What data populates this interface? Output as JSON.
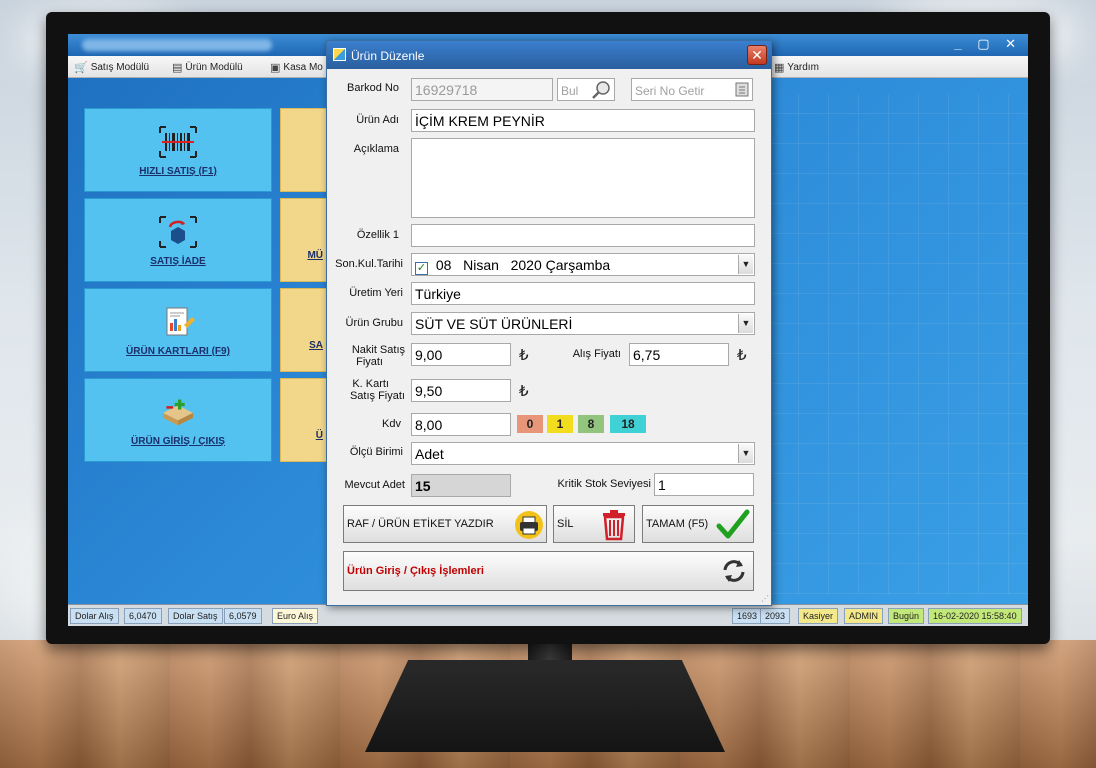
{
  "background_app": {
    "menu": [
      {
        "label": "Satış Modülü",
        "icon": "cart-icon"
      },
      {
        "label": "Ürün Modülü",
        "icon": "box-icon"
      },
      {
        "label": "Kasa Mo",
        "icon": "register-icon"
      },
      {
        "label": "Yardım",
        "icon": "help-icon"
      }
    ],
    "tiles": [
      {
        "label": "HIZLI SATIŞ (F1)",
        "icon": "barcode-icon"
      },
      {
        "label": "SATIŞ İADE",
        "icon": "return-box-icon"
      },
      {
        "label": "ÜRÜN KARTLARI (F9)",
        "icon": "report-icon"
      },
      {
        "label": "ÜRÜN GİRİŞ / ÇIKIŞ",
        "icon": "inventory-icon"
      }
    ],
    "partial_tiles": [
      "",
      "MÜ",
      "SA",
      "Ü"
    ],
    "status_bar": [
      {
        "label": "Dolar Alış",
        "value": "6,0470"
      },
      {
        "label": "Dolar Satış",
        "value": "6,0579"
      },
      {
        "label": "Euro Alış",
        "value": ""
      },
      {
        "label": "",
        "value": "1693"
      },
      {
        "label": "",
        "value": "2093"
      },
      {
        "label": "Kasiyer",
        "value": "ADMIN"
      },
      {
        "label": "Bugün",
        "value": "16-02-2020 15:58:40"
      }
    ]
  },
  "dialog": {
    "title": "Ürün Düzenle",
    "close_label": "✕",
    "fields": {
      "barkod_label": "Barkod No",
      "barkod_value": "16929718",
      "bul_placeholder": "Bul",
      "seri_placeholder": "Seri No Getir",
      "urun_adi_label": "Ürün Adı",
      "urun_adi_value": "İÇİM KREM PEYNİR",
      "aciklama_label": "Açıklama",
      "aciklama_value": "",
      "ozellik_label": "Özellik 1",
      "ozellik_value": "",
      "skt_label": "Son.Kul.Tarihi",
      "skt_day": "08",
      "skt_month": "Nisan",
      "skt_rest": "2020 Çarşamba",
      "uretim_label": "Üretim Yeri",
      "uretim_value": "Türkiye",
      "grup_label": "Ürün Grubu",
      "grup_value": "SÜT VE SÜT ÜRÜNLERİ",
      "nakit_label_1": "Nakit Satış",
      "nakit_label_2": "Fiyatı",
      "nakit_value": "9,00",
      "alis_label": "Alış Fiyatı",
      "alis_value": "6,75",
      "kk_label_1": "K. Kartı",
      "kk_label_2": "Satış Fiyatı",
      "kk_value": "9,50",
      "currency_symbol": "₺",
      "kdv_label": "Kdv",
      "kdv_value": "8,00",
      "kdv_options": [
        {
          "label": "0",
          "color": "#e8967a"
        },
        {
          "label": "1",
          "color": "#f2dc1e"
        },
        {
          "label": "8",
          "color": "#93c47d"
        },
        {
          "label": "18",
          "color": "#3fd1d6"
        }
      ],
      "olcu_label": "Ölçü Birimi",
      "olcu_value": "Adet",
      "mevcut_label": "Mevcut Adet",
      "mevcut_value": "15",
      "kritik_label": "Kritik Stok Seviyesi",
      "kritik_value": "1"
    },
    "buttons": {
      "etiket": "RAF / ÜRÜN ETİKET YAZDIR",
      "sil": "SİL",
      "tamam": "TAMAM (F5)",
      "giris_cikis": "Ürün Giriş / Çıkış İşlemleri"
    },
    "colors": {
      "giris_cikis_text": "#c00000",
      "check_green": "#1fa01f",
      "trash_red": "#d0202a"
    }
  }
}
